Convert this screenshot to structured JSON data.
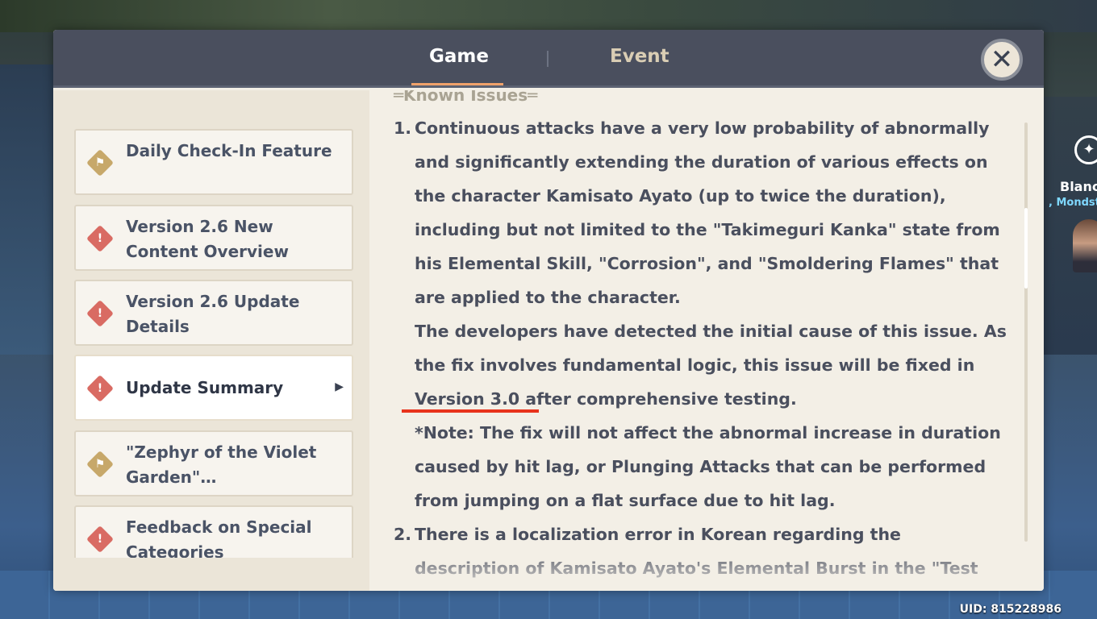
{
  "header": {
    "tabs": [
      {
        "label": "Game",
        "active": true
      },
      {
        "label": "Event",
        "active": false
      }
    ],
    "close_icon": "close-icon"
  },
  "sidebar": {
    "items": [
      {
        "label": "Daily Check-In Feature",
        "icon": "gold-diamond-flag-icon"
      },
      {
        "label": "Version 2.6 New Content Overview",
        "icon": "red-diamond-alert-icon"
      },
      {
        "label": "Version 2.6 Update Details",
        "icon": "red-diamond-alert-icon"
      },
      {
        "label": "Update Summary",
        "icon": "red-diamond-alert-icon",
        "selected": true
      },
      {
        "label": "\"Zephyr of the Violet Garden\"…",
        "icon": "gold-diamond-flag-icon"
      },
      {
        "label": "Feedback on Special Categories",
        "icon": "red-diamond-alert-icon"
      }
    ]
  },
  "content": {
    "section_heading": "═Known Issues═",
    "items": [
      {
        "number": "1.",
        "paragraphs": [
          "Continuous attacks have a very low probability of abnormally and significantly extending the duration of various effects on the character Kamisato Ayato (up to twice the duration), including but not limited to the \"Takimeguri Kanka\" state from his Elemental Skill, \"Corrosion\", and \"Smoldering Flames\" that are applied to the character.",
          "The developers have detected the initial cause of this issue. As the fix involves fundamental logic, this issue will be fixed in Version 3.0 after comprehensive testing.",
          "*Note: The fix will not affect the abnormal increase in duration caused by hit lag, or Plunging Attacks that can be performed from jumping on a flat surface due to hit lag."
        ]
      },
      {
        "number": "2.",
        "paragraphs": [
          "There is a localization error in Korean regarding the description of Kamisato Ayato's Elemental Burst in the \"Test"
        ]
      }
    ]
  },
  "side_peek": {
    "name": "Blanc",
    "region": ", Mondsta"
  },
  "uid": "UID: 815228986",
  "colors": {
    "header_bg": "#4a4f5e",
    "tab_underline": "#f0a26a",
    "panel_bg": "#f3efe6",
    "annotation_red": "#e8331c"
  }
}
